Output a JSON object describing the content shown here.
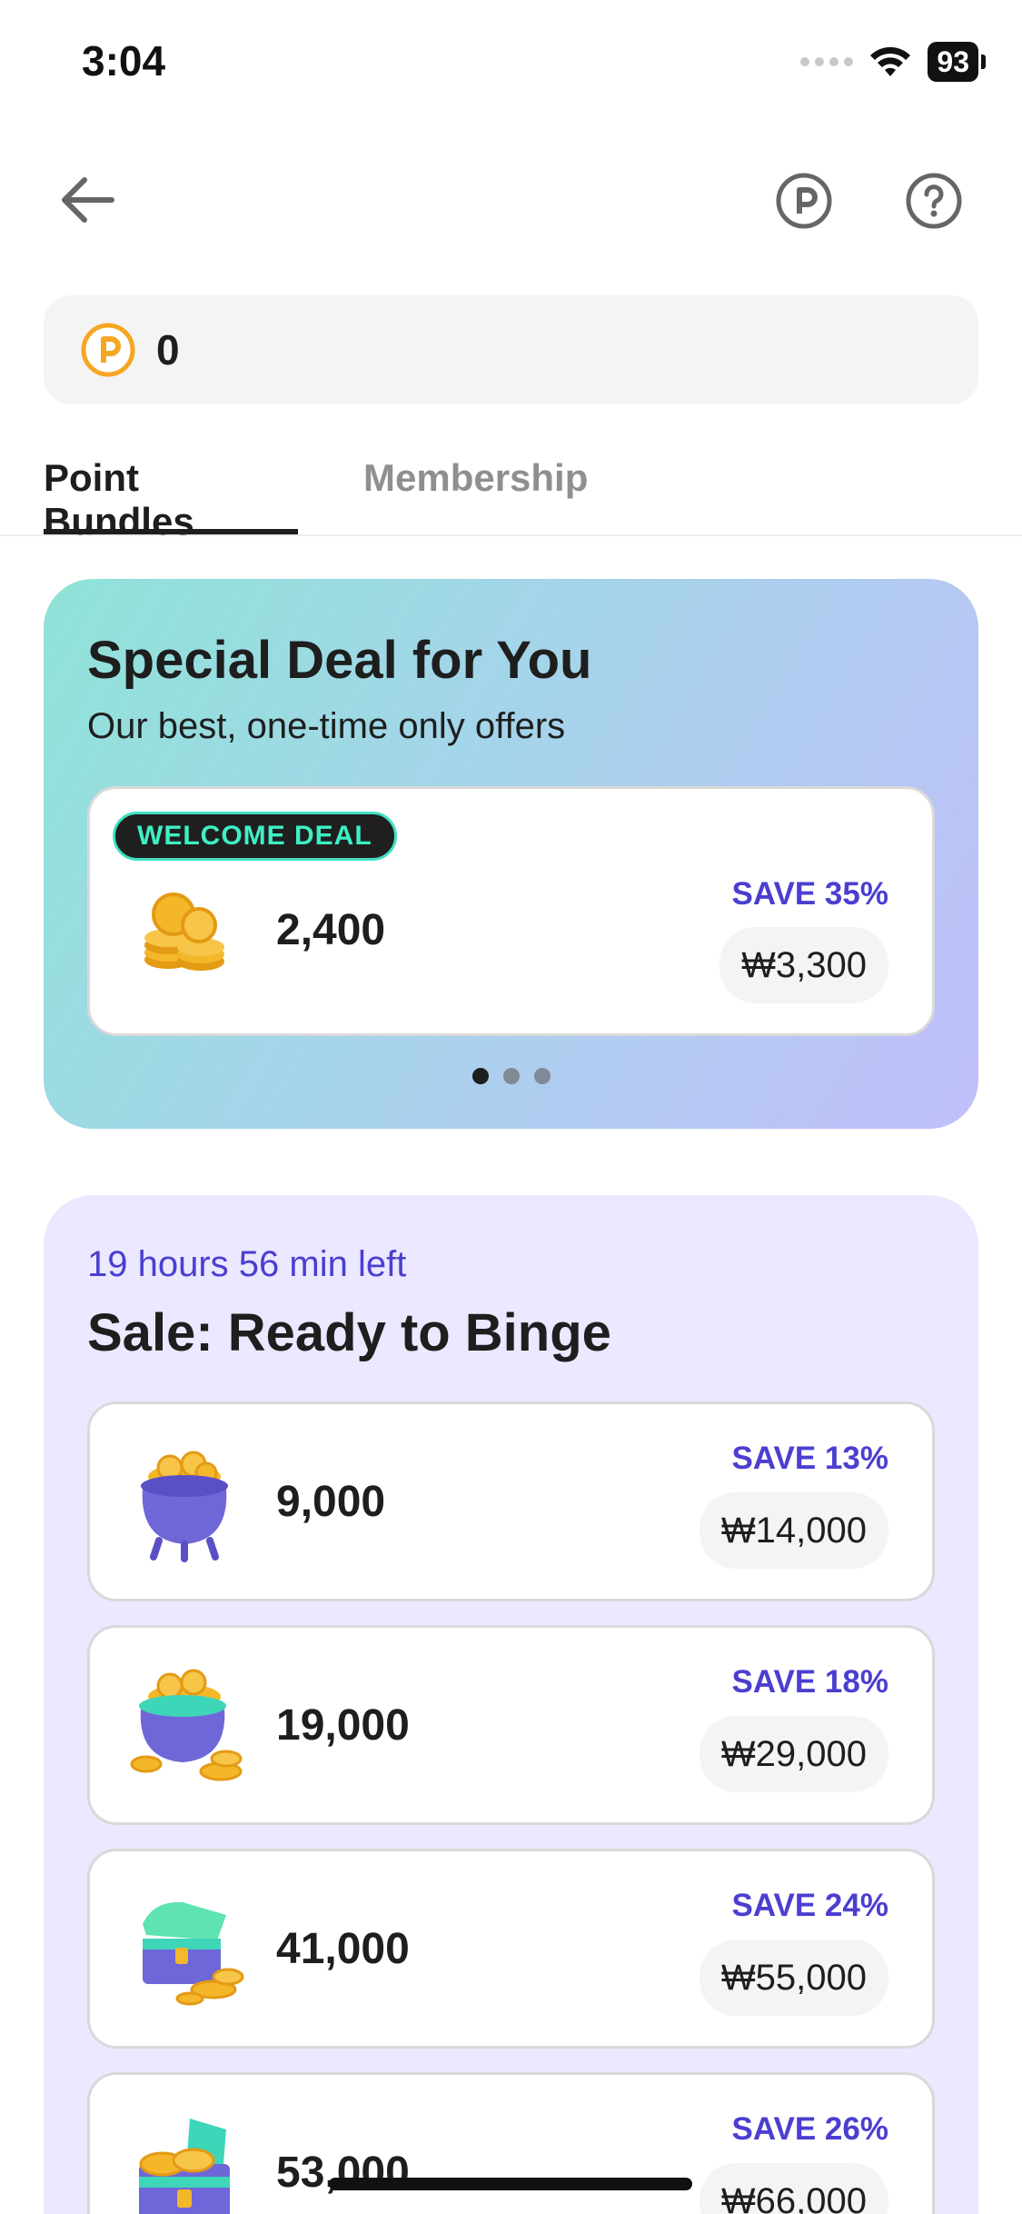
{
  "status_bar": {
    "time": "3:04",
    "battery": "93"
  },
  "header": {
    "back_icon": "arrow-left-icon",
    "point_icon": "point-circle-icon",
    "help_icon": "question-circle-icon"
  },
  "balance": {
    "value": "0",
    "icon": "point-coin-icon"
  },
  "tabs": [
    {
      "label": "Point Bundles",
      "active": true
    },
    {
      "label": "Membership",
      "active": false
    }
  ],
  "special_deal": {
    "title": "Special Deal for You",
    "subtitle": "Our best, one-time only offers",
    "badge": "WELCOME DEAL",
    "amount": "2,400",
    "save": "SAVE 35%",
    "price": "₩3,300",
    "pager": {
      "count": 3,
      "active_index": 0
    }
  },
  "sale": {
    "time_left": "19 hours 56 min left",
    "title": "Sale: Ready to Binge",
    "bundles": [
      {
        "amount": "9,000",
        "save": "SAVE 13%",
        "price": "₩14,000",
        "icon": "coin-pot-icon"
      },
      {
        "amount": "19,000",
        "save": "SAVE 18%",
        "price": "₩29,000",
        "icon": "coin-pot-overflow-icon"
      },
      {
        "amount": "41,000",
        "save": "SAVE 24%",
        "price": "₩55,000",
        "icon": "treasure-chest-icon"
      },
      {
        "amount": "53,000",
        "save": "SAVE 26%",
        "price": "₩66,000",
        "icon": "treasure-chest-full-icon"
      }
    ]
  },
  "colors": {
    "accent": "#4a3fd0",
    "badge_text": "#3ef0c4",
    "sale_bg": "#ebe8ff",
    "coin": "#f5a623"
  }
}
